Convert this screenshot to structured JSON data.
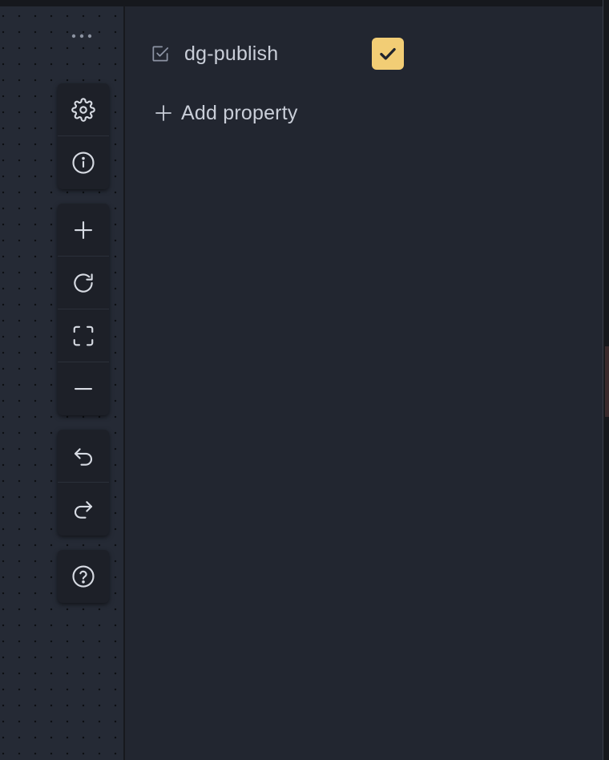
{
  "toolbar": {
    "groups": [
      [
        {
          "name": "settings",
          "icon": "gear-icon"
        },
        {
          "name": "info",
          "icon": "info-icon"
        }
      ],
      [
        {
          "name": "zoom-in",
          "icon": "plus-icon"
        },
        {
          "name": "refresh",
          "icon": "refresh-icon"
        },
        {
          "name": "fit-view",
          "icon": "fullscreen-icon"
        },
        {
          "name": "zoom-out",
          "icon": "minus-icon"
        }
      ],
      [
        {
          "name": "undo",
          "icon": "undo-icon"
        },
        {
          "name": "redo",
          "icon": "redo-icon"
        }
      ],
      [
        {
          "name": "help",
          "icon": "help-icon"
        }
      ]
    ]
  },
  "properties": [
    {
      "icon": "checkbox-property-icon",
      "name": "dg-publish",
      "checked": true
    }
  ],
  "add_property": {
    "icon": "plus-icon",
    "label": "Add property"
  },
  "colors": {
    "accent": "#f2cd75",
    "panel_bg": "#222630",
    "canvas_bg": "#252a35",
    "text": "#c9ced8",
    "icon": "#d7dbe3"
  }
}
